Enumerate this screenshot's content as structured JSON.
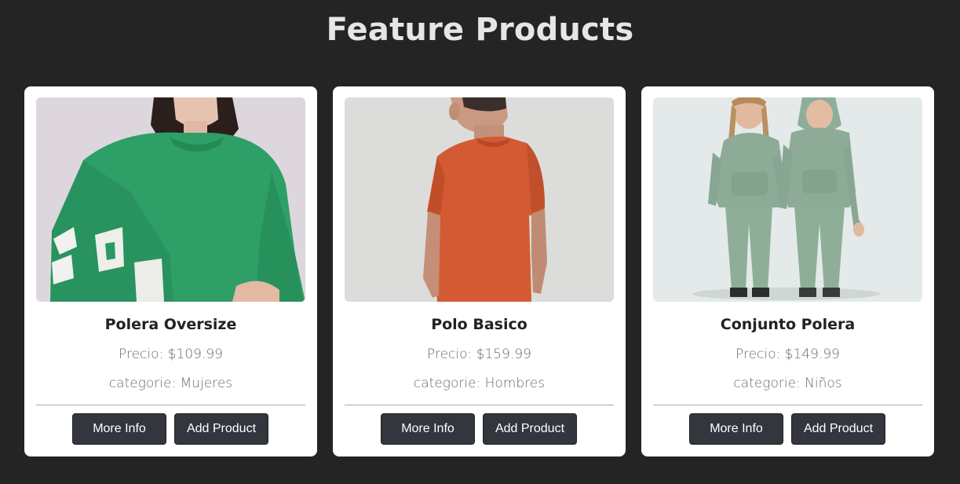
{
  "page": {
    "title": "Feature Products",
    "background": "#242424"
  },
  "buttons": {
    "more_info_label": "More Info",
    "add_product_label": "Add Product",
    "color": "#33373d"
  },
  "products": [
    {
      "name": "Polera Oversize",
      "price": "Precio: $109.99",
      "category": "categorie: Mujeres",
      "image": "woman-green-sweatshirt-photo",
      "accent": "#2fa56a"
    },
    {
      "name": "Polo Basico",
      "price": "Precio: $159.99",
      "category": "categorie: Hombres",
      "image": "man-orange-tshirt-photo",
      "accent": "#d45a33"
    },
    {
      "name": "Conjunto Polera",
      "price": "Precio: $149.99",
      "category": "categorie: Niños",
      "image": "kids-sage-tracksuit-photo",
      "accent": "#8fae98"
    }
  ]
}
